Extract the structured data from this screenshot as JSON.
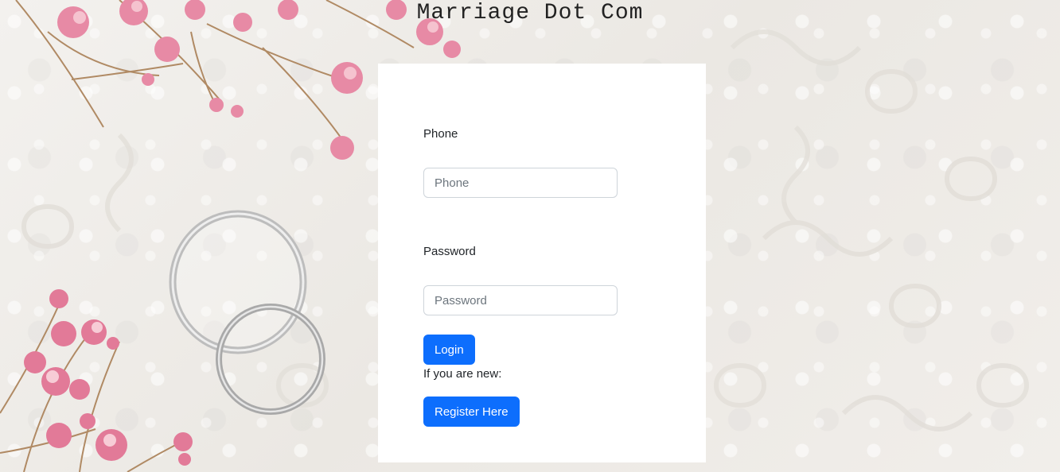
{
  "header": {
    "title": "Marriage Dot Com"
  },
  "login_form": {
    "phone_label": "Phone",
    "phone_placeholder": "Phone",
    "phone_value": "",
    "password_label": "Password",
    "password_placeholder": "Password",
    "password_value": "",
    "login_button": "Login",
    "new_user_text": "If you are new:",
    "register_button": "Register Here"
  },
  "colors": {
    "primary_button": "#0d6efd",
    "card_background": "#ffffff",
    "page_background": "#efece8"
  },
  "decorations": [
    "flower-sprig-icon",
    "wedding-rings-icon"
  ]
}
